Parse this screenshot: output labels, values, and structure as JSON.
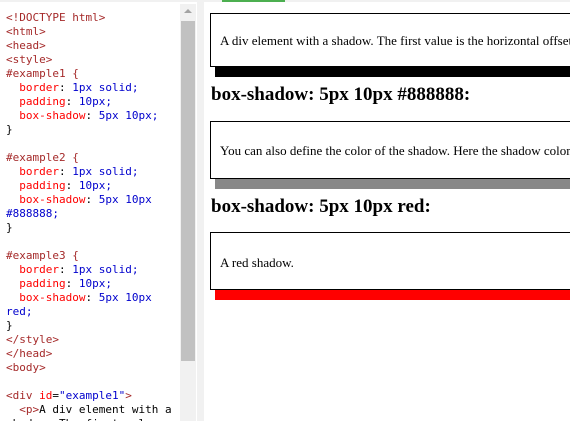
{
  "editor": {
    "lines": [
      [
        [
          "t",
          "<!DOCTYPE html>"
        ]
      ],
      [
        [
          "t",
          "<html>"
        ]
      ],
      [
        [
          "t",
          "<head>"
        ]
      ],
      [
        [
          "t",
          "<style>"
        ]
      ],
      [
        [
          "t",
          "#example1 {"
        ]
      ],
      [
        [
          "",
          "  "
        ],
        [
          "p",
          "border"
        ],
        [
          "",
          ": "
        ],
        [
          "b",
          "1px solid;"
        ]
      ],
      [
        [
          "",
          "  "
        ],
        [
          "p",
          "padding"
        ],
        [
          "",
          ": "
        ],
        [
          "b",
          "10px;"
        ]
      ],
      [
        [
          "",
          "  "
        ],
        [
          "p",
          "box-shadow"
        ],
        [
          "",
          ": "
        ],
        [
          "b",
          "5px 10px;"
        ]
      ],
      [
        [
          "",
          "}"
        ]
      ],
      [
        [
          "",
          ""
        ]
      ],
      [
        [
          "t",
          "#example2 {"
        ]
      ],
      [
        [
          "",
          "  "
        ],
        [
          "p",
          "border"
        ],
        [
          "",
          ": "
        ],
        [
          "b",
          "1px solid;"
        ]
      ],
      [
        [
          "",
          "  "
        ],
        [
          "p",
          "padding"
        ],
        [
          "",
          ": "
        ],
        [
          "b",
          "10px;"
        ]
      ],
      [
        [
          "",
          "  "
        ],
        [
          "p",
          "box-shadow"
        ],
        [
          "",
          ": "
        ],
        [
          "b",
          "5px 10px"
        ]
      ],
      [
        [
          "b",
          "#888888;"
        ]
      ],
      [
        [
          "",
          "}"
        ]
      ],
      [
        [
          "",
          ""
        ]
      ],
      [
        [
          "t",
          "#example3 {"
        ]
      ],
      [
        [
          "",
          "  "
        ],
        [
          "p",
          "border"
        ],
        [
          "",
          ": "
        ],
        [
          "b",
          "1px solid;"
        ]
      ],
      [
        [
          "",
          "  "
        ],
        [
          "p",
          "padding"
        ],
        [
          "",
          ": "
        ],
        [
          "b",
          "10px;"
        ]
      ],
      [
        [
          "",
          "  "
        ],
        [
          "p",
          "box-shadow"
        ],
        [
          "",
          ": "
        ],
        [
          "b",
          "5px 10px"
        ]
      ],
      [
        [
          "b",
          "red;"
        ]
      ],
      [
        [
          "",
          "}"
        ]
      ],
      [
        [
          "t",
          "</style>"
        ]
      ],
      [
        [
          "t",
          "</head>"
        ]
      ],
      [
        [
          "t",
          "<body>"
        ]
      ],
      [
        [
          "",
          ""
        ]
      ],
      [
        [
          "t",
          "<div "
        ],
        [
          "p",
          "id"
        ],
        [
          "",
          "="
        ],
        [
          "b",
          "\"example1\""
        ],
        [
          "t",
          ">"
        ]
      ],
      [
        [
          "",
          "  "
        ],
        [
          "t",
          "<p>"
        ],
        [
          "",
          "A div element with a"
        ]
      ],
      [
        [
          "",
          "shadow. The first value"
        ]
      ]
    ]
  },
  "result": {
    "example1_text": "A div element with a shadow. The first value is the horizontal offset and the second value is the vertical offset.",
    "heading2": "box-shadow: 5px 10px #888888:",
    "example2_text": "You can also define the color of the shadow. Here the shadow color is grey.",
    "heading3": "box-shadow: 5px 10px red:",
    "example3_text": "A red shadow."
  },
  "colors": {
    "shadow1": "#000000",
    "shadow2": "#888888",
    "shadow3": "#ff0000",
    "accent": "#4caf50"
  }
}
